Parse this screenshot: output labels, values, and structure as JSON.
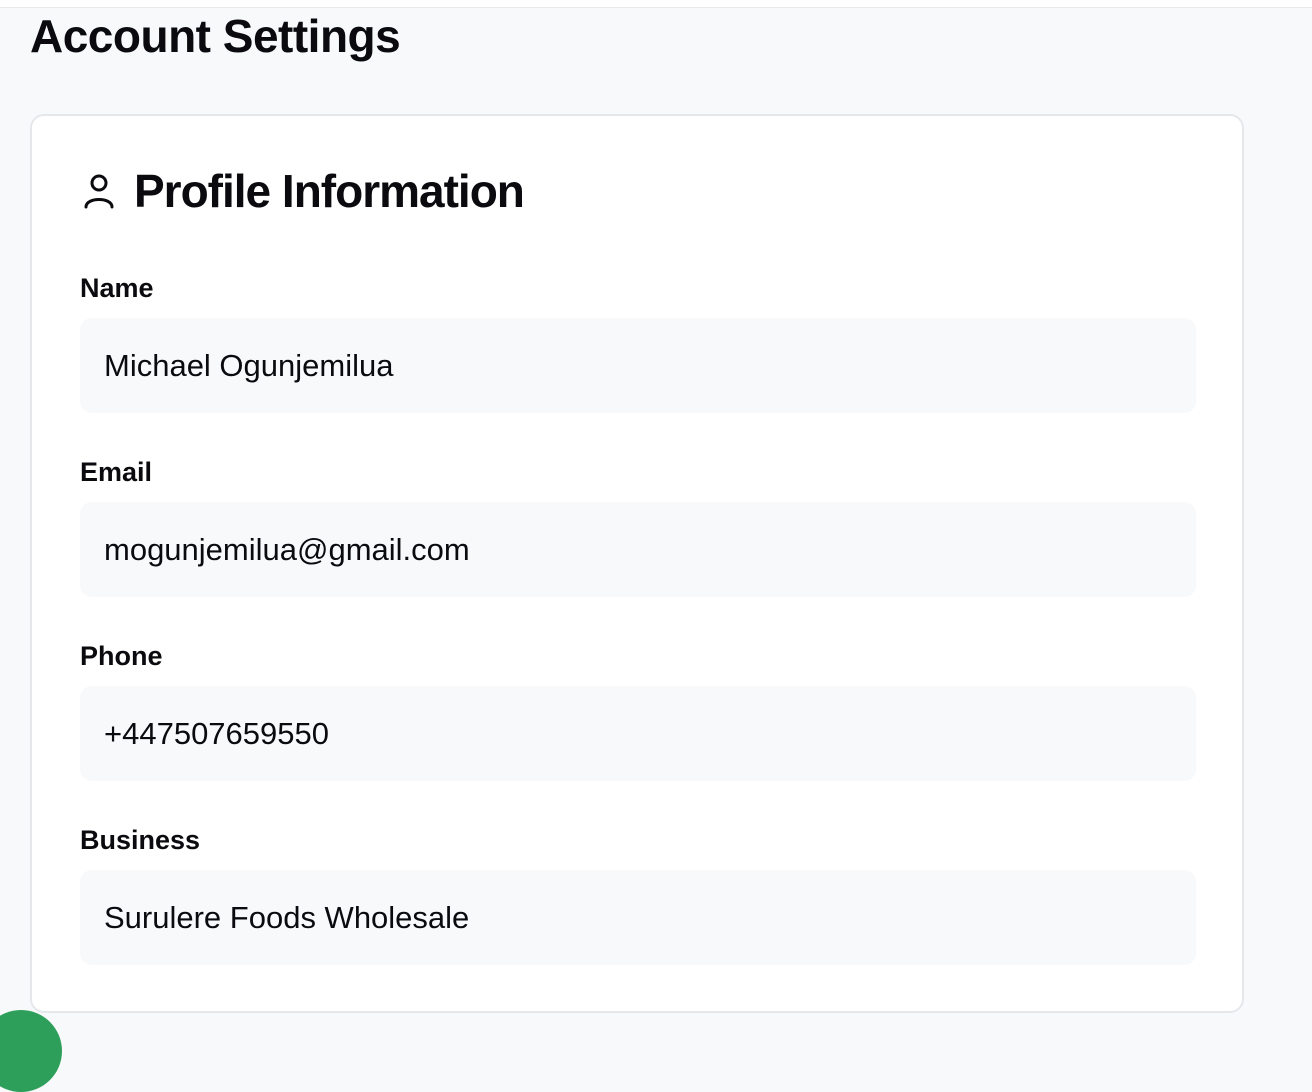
{
  "page": {
    "title": "Account Settings"
  },
  "profile_card": {
    "title": "Profile Information",
    "icon": "user-icon",
    "fields": {
      "name": {
        "label": "Name",
        "value": "Michael Ogunjemilua"
      },
      "email": {
        "label": "Email",
        "value": "mogunjemilua@gmail.com"
      },
      "phone": {
        "label": "Phone",
        "value": "+447507659550"
      },
      "business": {
        "label": "Business",
        "value": "Surulere Foods Wholesale"
      }
    }
  },
  "colors": {
    "page_background": "#f8f9fb",
    "card_background": "#ffffff",
    "card_border": "#e5e7eb",
    "input_background": "#f8f9fb",
    "text": "#0b0b0f",
    "chat_button": "#2e9f5b"
  }
}
